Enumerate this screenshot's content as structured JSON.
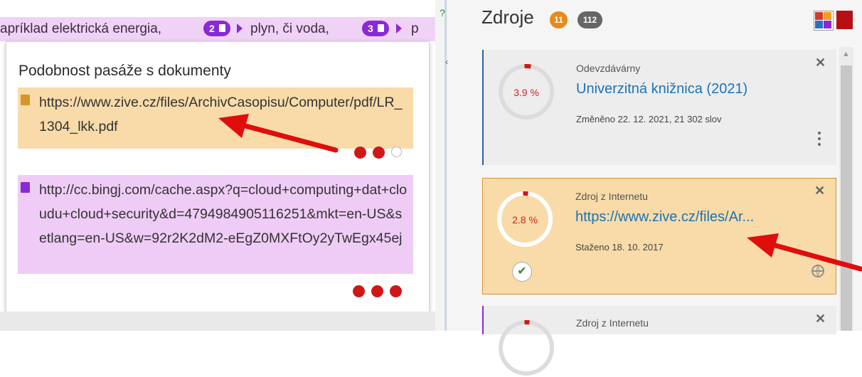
{
  "highlight_strip": {
    "text_1": "apríklad elektrická energia,",
    "pill_1": "2",
    "text_2": "plyn, či voda,",
    "pill_2": "3",
    "text_3": "p"
  },
  "popup": {
    "title": "Podobnost pasáže s dokumenty",
    "matches": [
      {
        "url": "https://www.zive.cz/files/ArchivCasopisu/Computer/pdf/LR_1304_lkk.pdf",
        "dots_filled": 2,
        "dots_total": 3,
        "color": "#f8dba8"
      },
      {
        "url": "http://cc.bingj.com/cache.aspx?q=cloud+computing+dat+cloudu+cloud+security&d=4794984905116251&mkt=en-US&setlang=en-US&w=92r2K2dM2-eEgZ0MXFtOy2yTwEgx45ej",
        "dots_filled": 3,
        "dots_total": 3,
        "color": "#efccf6"
      }
    ]
  },
  "sources_panel": {
    "title": "Zdroje",
    "badge_highlighted": "11",
    "badge_total": "112",
    "cards": [
      {
        "percent": "3.9 %",
        "percent_value": 3.9,
        "type": "Odevzdávárny",
        "name": "Univerzitná knižnica (2021)",
        "date": "Změněno 22. 12. 2021, 21 302 slov"
      },
      {
        "percent": "2.8 %",
        "percent_value": 2.8,
        "type": "Zdroj z Internetu",
        "name": "https://www.zive.cz/files/Ar...",
        "date": "Staženo 18. 10. 2017"
      },
      {
        "type": "Zdroj z Internetu"
      }
    ]
  },
  "colors": {
    "accent_red": "#d01717",
    "purple": "#8a29d6",
    "orange": "#e88a1a",
    "link_blue": "#1a73b8"
  },
  "icons": [
    "document-icon",
    "play-triangle-icon",
    "close-icon",
    "kebab-menu-icon",
    "check-icon",
    "globe-icon",
    "grid-view-icon",
    "red-square-icon",
    "red-arrow"
  ]
}
